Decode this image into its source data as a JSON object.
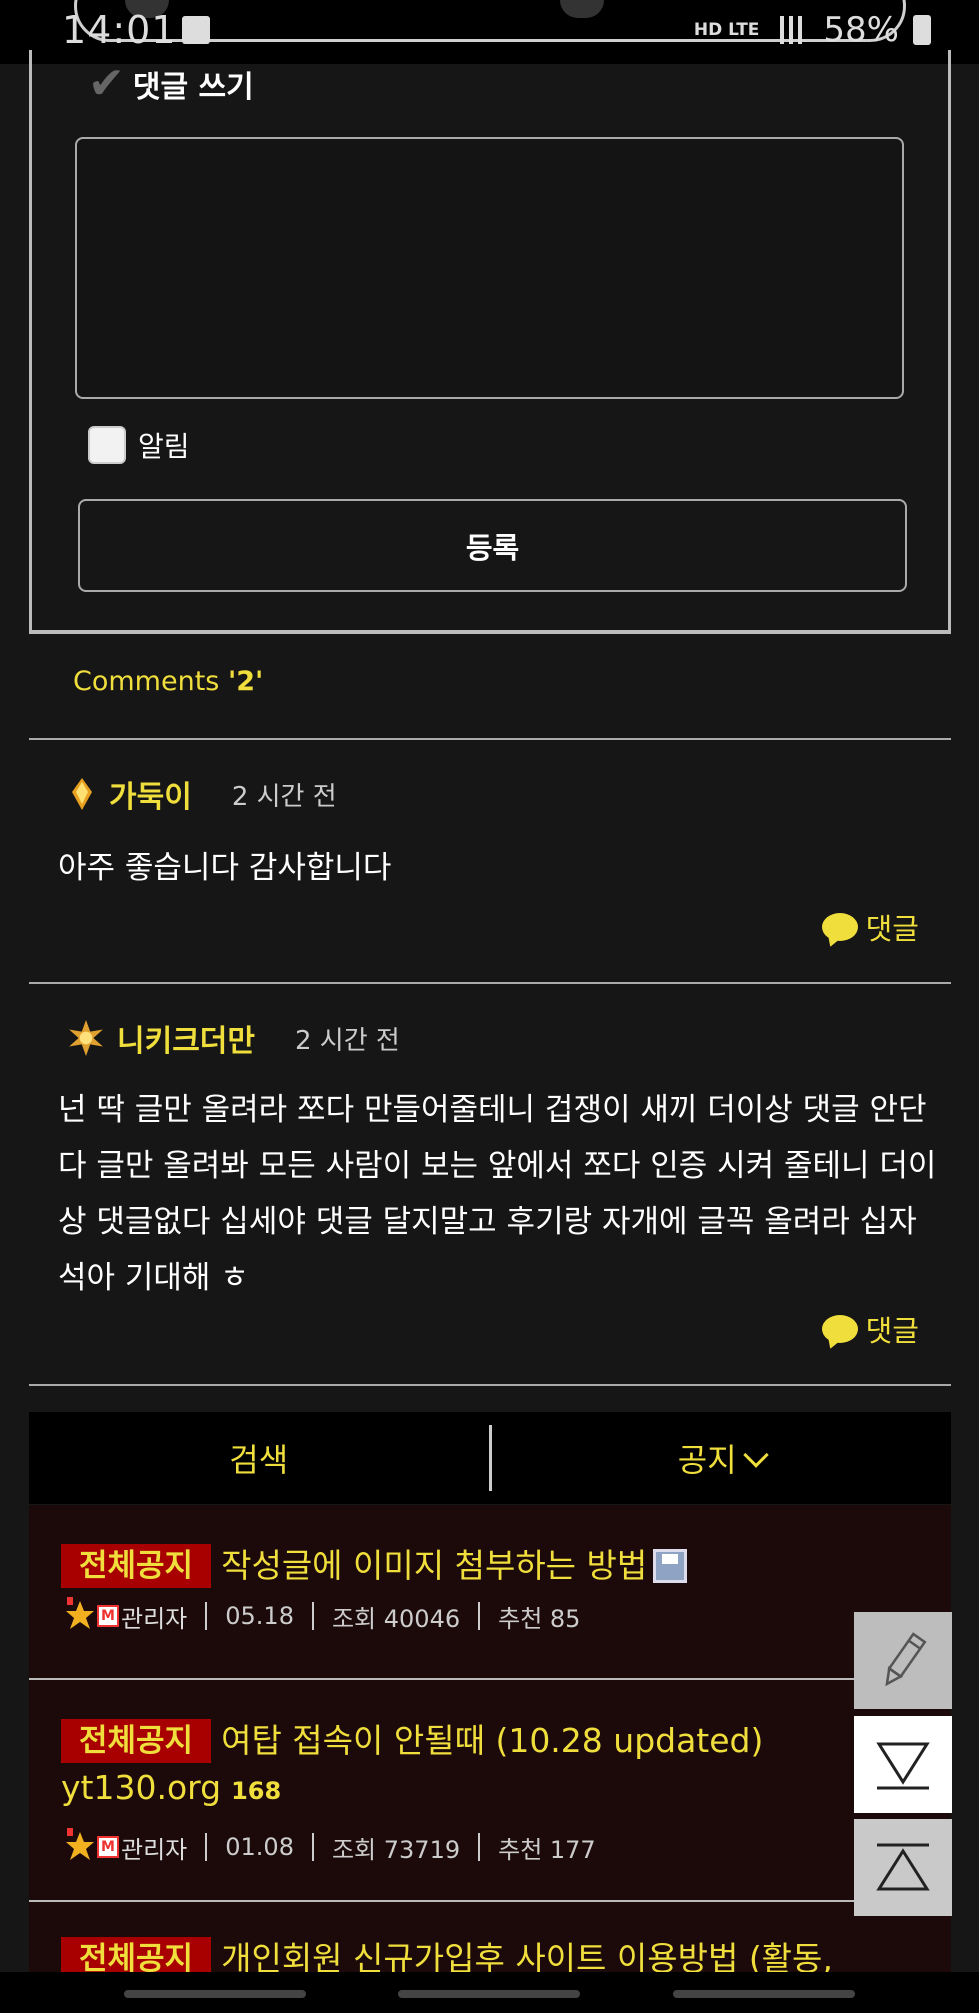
{
  "status_bar": {
    "time": "14:01",
    "network": "HD LTE",
    "battery": "58%"
  },
  "comment_form": {
    "title": "댓글 쓰기",
    "notify_label": "알림",
    "submit_label": "등록"
  },
  "comments": {
    "header_prefix": "Comments ",
    "header_count": "'2'",
    "items": [
      {
        "author": "가둑이",
        "time": "2 시간 전",
        "text": "아주 좋습니다 감사합니다",
        "reply_label": "댓글"
      },
      {
        "author": "니키크더만",
        "time": "2 시간 전",
        "text": "넌 딱 글만 올려라 쪼다 만들어줄테니 겁쟁이 새끼 더이상 댓글 안단다 글만 올려봐 모든 사람이 보는 앞에서 쪼다 인증 시켜 줄테니 더이상 댓글없다 십세야 댓글 달지말고 후기랑 자개에 글꼭 올려라 십자석아 기대해 ㅎ",
        "reply_label": "댓글"
      }
    ]
  },
  "tabs": {
    "search": "검색",
    "notice": "공지"
  },
  "notices": [
    {
      "tag": "전체공지",
      "title": "작성글에 이미지 첨부하는 방법",
      "author": "관리자",
      "date": "05.18",
      "views": "조회 40046",
      "likes": "추천 85"
    },
    {
      "tag": "전체공지",
      "title": "여탑 접속이 안될때 (10.28 updated)",
      "title_line2": "yt130.org",
      "comment_count": "168",
      "author": "관리자",
      "date": "01.08",
      "views": "조회 73719",
      "likes": "추천 177"
    },
    {
      "tag": "전체공지",
      "title": "개인회원 신규가입후 사이트 이용방법 (활동,"
    }
  ],
  "colors": {
    "accent": "#f0de3c",
    "tag_bg": "#a80000",
    "background": "#161616"
  }
}
